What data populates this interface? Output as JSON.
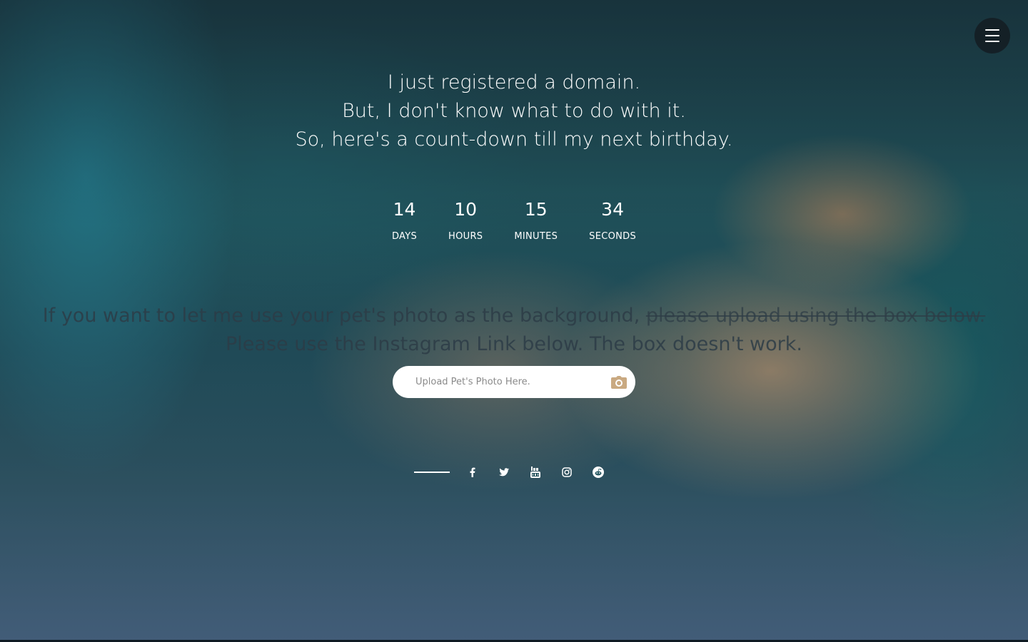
{
  "menu": {
    "icon": "hamburger-menu-icon"
  },
  "intro": {
    "line1": "I just registered a domain.",
    "line2": "But, I don't know what to do with it.",
    "line3": "So, here's a count-down till my next birthday."
  },
  "countdown": {
    "days": {
      "value": "14",
      "label": "DAYS"
    },
    "hours": {
      "value": "10",
      "label": "HOURS"
    },
    "minutes": {
      "value": "15",
      "label": "MINUTES"
    },
    "seconds": {
      "value": "34",
      "label": "SECONDS"
    }
  },
  "pet_message": {
    "line1_plain": "If you want to let me use your pet's photo as the background, ",
    "line1_struck": "please upload using the box below.",
    "line2": "Please use the Instagram Link below. The box doesn't work."
  },
  "upload": {
    "placeholder": "Upload Pet's Photo Here.",
    "icon": "camera-icon"
  },
  "social": {
    "icons": [
      "facebook-icon",
      "twitter-icon",
      "youtube-icon",
      "instagram-icon",
      "reddit-icon"
    ]
  },
  "colors": {
    "text": "#ffffff",
    "muted_text": "#2d3c46",
    "camera_accent": "#c9a981",
    "menu_bg": "#141c22"
  }
}
